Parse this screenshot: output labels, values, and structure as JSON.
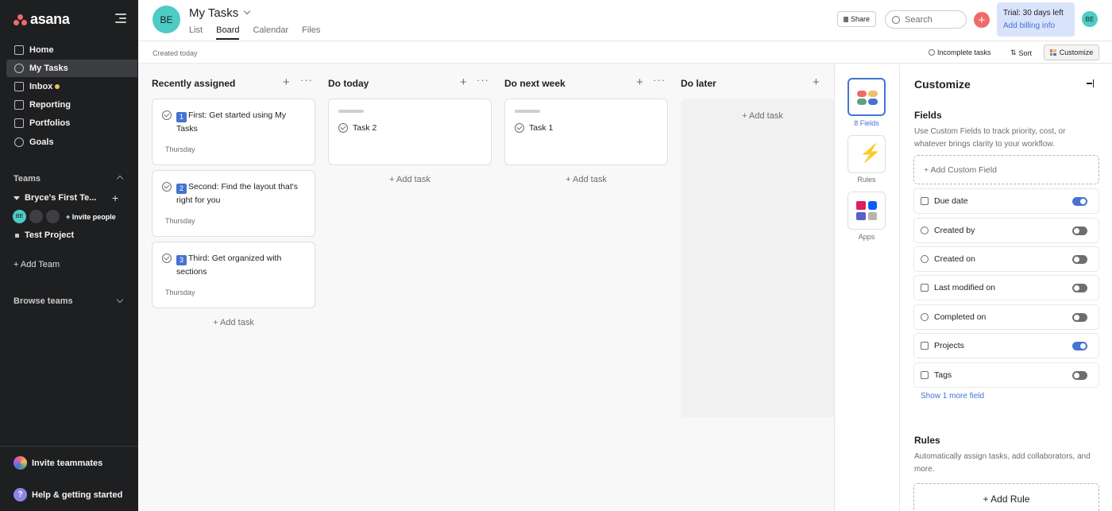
{
  "brand": {
    "name": "asana"
  },
  "sidebar": {
    "nav": [
      {
        "label": "Home",
        "icon": "home-icon"
      },
      {
        "label": "My Tasks",
        "icon": "check-circle-icon",
        "active": true
      },
      {
        "label": "Inbox",
        "icon": "bell-icon",
        "unread": true
      },
      {
        "label": "Reporting",
        "icon": "chart-line-icon"
      },
      {
        "label": "Portfolios",
        "icon": "folder-icon"
      },
      {
        "label": "Goals",
        "icon": "person-goal-icon"
      }
    ],
    "teams_label": "Teams",
    "team_name": "Bryce's First Te...",
    "avatar_initials": "BE",
    "invite_people": "+ Invite people",
    "project_name": "Test Project",
    "add_team": "+ Add Team",
    "browse_teams": "Browse teams",
    "invite_teammates": "Invite teammates",
    "help": "Help & getting started",
    "help_icon_glyph": "?"
  },
  "header": {
    "avatar_initials": "BE",
    "title": "My Tasks",
    "tabs": [
      {
        "label": "List"
      },
      {
        "label": "Board",
        "active": true
      },
      {
        "label": "Calendar"
      },
      {
        "label": "Files"
      }
    ],
    "share": "Share",
    "search_placeholder": "Search",
    "plus_glyph": "+",
    "trial_text": "Trial: 30 days left",
    "trial_link": "Add billing info",
    "user_initials": "BE"
  },
  "subbar": {
    "created": "Created today",
    "incomplete": "Incomplete tasks",
    "sort": "Sort",
    "customize": "Customize"
  },
  "board": {
    "add_task": "+ Add task",
    "columns": [
      {
        "title": "Recently assigned",
        "tasks": [
          {
            "badge": "1",
            "name": "First: Get started using My Tasks",
            "due": "Thursday"
          },
          {
            "badge": "2",
            "name": "Second: Find the layout that's right for you",
            "due": "Thursday"
          },
          {
            "badge": "3",
            "name": "Third: Get organized with sections",
            "due": "Thursday"
          }
        ]
      },
      {
        "title": "Do today",
        "tasks": [
          {
            "name": "Task 2"
          }
        ]
      },
      {
        "title": "Do next week",
        "tasks": [
          {
            "name": "Task 1"
          }
        ]
      },
      {
        "title": "Do later",
        "tasks": []
      }
    ]
  },
  "customize": {
    "rail": [
      {
        "label": "8 Fields",
        "icon": "fields-icon",
        "active": true
      },
      {
        "label": "Rules",
        "icon": "lightning-icon"
      },
      {
        "label": "Apps",
        "icon": "apps-icon"
      }
    ],
    "title": "Customize",
    "fields_heading": "Fields",
    "fields_desc": "Use Custom Fields to track priority, cost, or whatever brings clarity to your workflow.",
    "add_custom_field": "+ Add Custom Field",
    "fields": [
      {
        "label": "Due date",
        "icon": "calendar-icon",
        "on": true
      },
      {
        "label": "Created by",
        "icon": "person-icon",
        "on": false
      },
      {
        "label": "Created on",
        "icon": "clock-icon",
        "on": false
      },
      {
        "label": "Last modified on",
        "icon": "pencil-icon",
        "on": false
      },
      {
        "label": "Completed on",
        "icon": "check-circle-icon",
        "on": false
      },
      {
        "label": "Projects",
        "icon": "clipboard-icon",
        "on": true
      },
      {
        "label": "Tags",
        "icon": "tag-icon",
        "on": false
      }
    ],
    "show_more": "Show 1 more field",
    "rules_heading": "Rules",
    "rules_desc": "Automatically assign tasks, add collaborators, and more.",
    "add_rule": "+ Add Rule"
  },
  "colors": {
    "sidebar_bg": "#1e1f21",
    "accent_blue": "#4573d2",
    "brand_coral": "#f06a6a",
    "avatar_teal": "#4ecbc4",
    "trial_bg": "#d9e3fc"
  }
}
